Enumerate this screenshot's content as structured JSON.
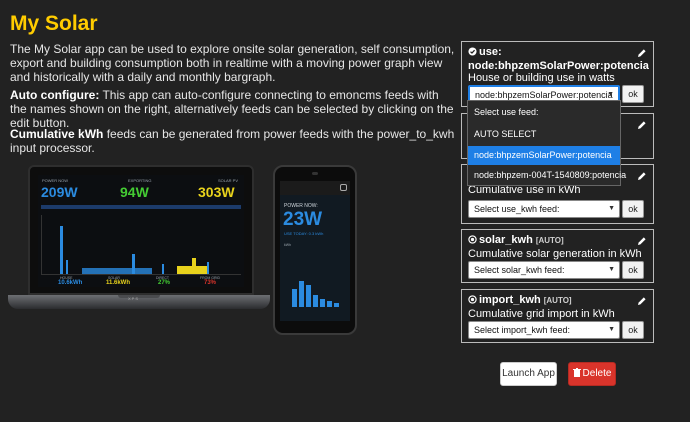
{
  "page": {
    "title": "My Solar",
    "intro": "The My Solar app can be used to explore onsite solar generation, self consumption, export and building consumption both in realtime with a moving power graph view and historically with a daily and monthly bargraph.",
    "autoconfig_label": "Auto configure:",
    "autoconfig_text": " This app can auto-configure connecting to emoncms feeds with the names shown on the right, alternatively feeds can be selected by clicking on the edit button.",
    "cumulative_label": "Cumulative kWh",
    "cumulative_text": " feeds can be generated from power feeds with the power_to_kwh input processor."
  },
  "laptop": {
    "power_now_label": "POWER NOW",
    "exporting_label": "EXPORTING",
    "solar_pv_label": "SOLAR PV",
    "use_value": "209W",
    "export_value": "94W",
    "solar_value": "303W",
    "stats_labels": [
      "HOUSE",
      "SOLAR",
      "DIRECT",
      "FROM GRID"
    ],
    "stats_values": [
      "10.6kWh",
      "11.6kWh",
      "27%",
      "73%"
    ],
    "brand": "XPS"
  },
  "phone": {
    "power_now_label": "POWER NOW:",
    "power_value": "23W",
    "use_today": "USE TODAY: 0.3 kWh",
    "kwh_label": "kWh"
  },
  "feeds": [
    {
      "name": "use:",
      "feed_value": "node:bhpzemSolarPower:potencia",
      "description": "House or building use in watts",
      "selected": "node:bhpzemSolarPower:potencia",
      "ok": "ok"
    },
    {
      "description": "Cumulative use in kWh",
      "selected": "Select use_kwh feed:",
      "ok": "ok"
    },
    {
      "name": "solar_kwh",
      "badge": "[AUTO]",
      "description": "Cumulative solar generation in kWh",
      "selected": "Select solar_kwh feed:",
      "ok": "ok"
    },
    {
      "name": "import_kwh",
      "badge": "[AUTO]",
      "description": "Cumulative grid import in kWh",
      "selected": "Select import_kwh feed:",
      "ok": "ok"
    }
  ],
  "dropdown": {
    "options": [
      "Select use feed:",
      "AUTO SELECT",
      "node:bhpzemSolarPower:potencia",
      "node:bhpzem-004T-1540809:potencia"
    ],
    "selected_index": 2
  },
  "buttons": {
    "launch": "Launch App",
    "delete": "Delete"
  },
  "colors": {
    "accent": "#ffcc00",
    "use_blue": "#2b8be0",
    "export_green": "#44cc33",
    "solar_yellow": "#e8d21c",
    "dropdown_selected": "#1e7fe6",
    "delete_red": "#d9342b"
  },
  "icons": {
    "edit": "pencil-icon",
    "use_status": "check-circle-icon",
    "auto_status": "radio-dot-icon",
    "delete": "trash-icon"
  }
}
